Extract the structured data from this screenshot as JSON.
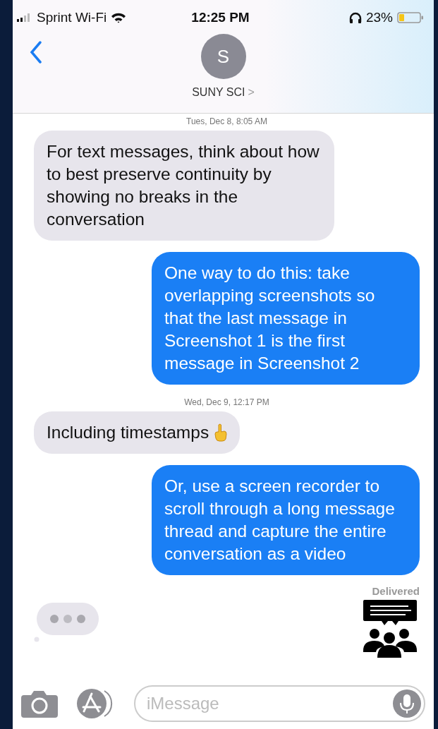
{
  "status_bar": {
    "carrier": "Sprint Wi-Fi",
    "time": "12:25 PM",
    "battery": "23%"
  },
  "header": {
    "avatar_letter": "S",
    "contact": "SUNY SCI",
    "chevron": ">"
  },
  "thread": [
    {
      "kind": "timestamp",
      "text": "Tues, Dec 8, 8:05 AM"
    },
    {
      "kind": "received",
      "text": "For text messages, think about how to best preserve continuity by showing no breaks in the conversation"
    },
    {
      "kind": "sent",
      "text": "One way to do this: take overlapping screenshots so that the last message in Screenshot 1 is the first message in Screenshot 2"
    },
    {
      "kind": "timestamp",
      "text": "Wed, Dec 9, 12:17 PM"
    },
    {
      "kind": "received",
      "text": "Including timestamps",
      "emoji": true
    },
    {
      "kind": "sent",
      "text": "Or, use a screen recorder to scroll through a long message thread and capture the entire conversation as a video"
    },
    {
      "kind": "status",
      "text": "Delivered"
    },
    {
      "kind": "typing"
    }
  ],
  "composer": {
    "placeholder": "iMessage"
  }
}
